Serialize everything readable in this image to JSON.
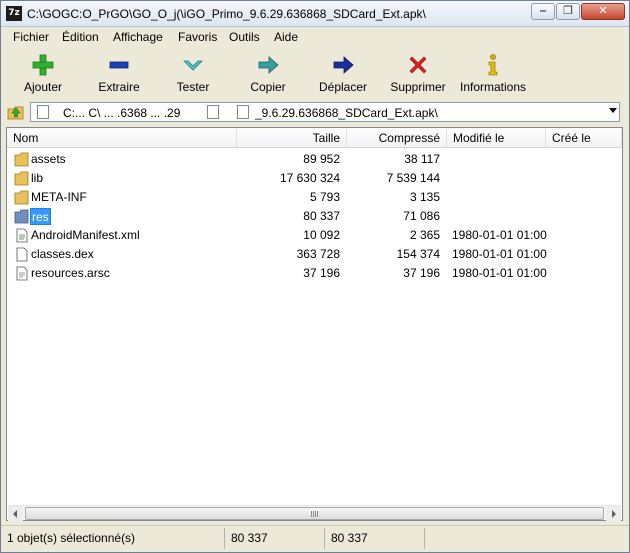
{
  "window": {
    "title": "C:\\GOGC:O_PrGO\\GO_O_j(\\iGO_Primo_9.6.29.636868_SDCard_Ext.apk\\",
    "app_icon_text": "7z"
  },
  "menu": [
    "Fichier",
    "Édition",
    "Affichage",
    "Favoris",
    "Outils",
    "Aide"
  ],
  "toolbar": {
    "add": "Ajouter",
    "extract": "Extraire",
    "test": "Tester",
    "copy": "Copier",
    "move": "Déplacer",
    "delete": "Supprimer",
    "info": "Informations"
  },
  "address": {
    "path_start": "C:...  C\\ ...  .6368 ...  .29",
    "path_end": "_9.6.29.636868_SDCard_Ext.apk\\"
  },
  "columns": {
    "name": "Nom",
    "size": "Taille",
    "packed": "Compressé",
    "modified": "Modifié le",
    "created": "Créé le"
  },
  "files": [
    {
      "name": "assets",
      "type": "folder",
      "size": "89 952",
      "packed": "38 117",
      "modified": ""
    },
    {
      "name": "lib",
      "type": "folder",
      "size": "17 630 324",
      "packed": "7 539 144",
      "modified": ""
    },
    {
      "name": "META-INF",
      "type": "folder",
      "size": "5 793",
      "packed": "3 135",
      "modified": ""
    },
    {
      "name": "res",
      "type": "folder",
      "size": "80 337",
      "packed": "71 086",
      "modified": "",
      "selected": true
    },
    {
      "name": "AndroidManifest.xml",
      "type": "file",
      "size": "10 092",
      "packed": "2 365",
      "modified": "1980-01-01 01:00"
    },
    {
      "name": "classes.dex",
      "type": "file",
      "size": "363 728",
      "packed": "154 374",
      "modified": "1980-01-01 01:00"
    },
    {
      "name": "resources.arsc",
      "type": "file",
      "size": "37 196",
      "packed": "37 196",
      "modified": "1980-01-01 01:00"
    }
  ],
  "status": {
    "selection": "1 objet(s) sélectionné(s)",
    "size": "80 337",
    "packed": "80 337"
  },
  "colors": {
    "selection": "#3399ff",
    "folder": "#e8c15a",
    "add_icon": "#2fb12f",
    "delete_icon": "#e02020",
    "move_icon": "#1a2f9a"
  }
}
